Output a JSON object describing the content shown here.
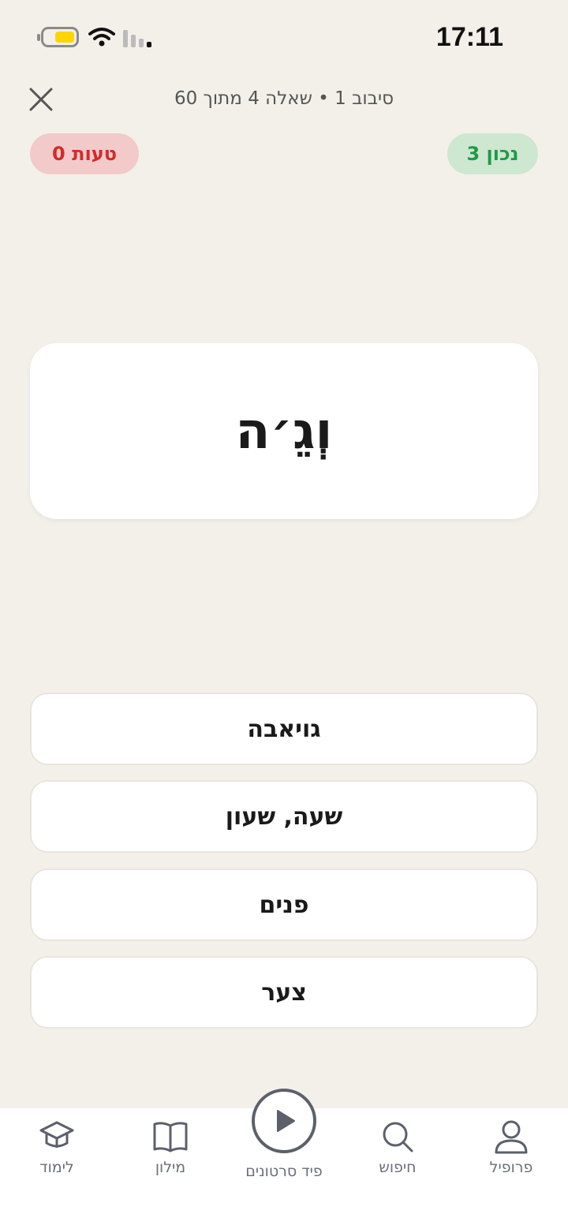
{
  "status_bar": {
    "time": "17:11",
    "battery_color": "#FFD400"
  },
  "header": {
    "progress_text": "סיבוב 1 • שאלה 4 מתוך 60",
    "close_icon": "close-icon"
  },
  "score": {
    "correct_label": "נכון 3",
    "mistakes_label": "טעות 0",
    "correct_color": "#1F9A46",
    "mistakes_color": "#D22B2B"
  },
  "question": {
    "word": "וְגֵ׳ה"
  },
  "options": [
    {
      "label": "גויאבה"
    },
    {
      "label": "שעה, שעון"
    },
    {
      "label": "פנים"
    },
    {
      "label": "צער"
    }
  ],
  "tabbar": {
    "learn": {
      "label": "לימוד",
      "icon": "graduation-cap-icon"
    },
    "dictionary": {
      "label": "מילון",
      "icon": "book-icon"
    },
    "feed": {
      "label": "פיד סרטונים",
      "icon": "play-icon"
    },
    "search": {
      "label": "חיפוש",
      "icon": "search-icon"
    },
    "profile": {
      "label": "פרופיל",
      "icon": "person-icon"
    }
  }
}
